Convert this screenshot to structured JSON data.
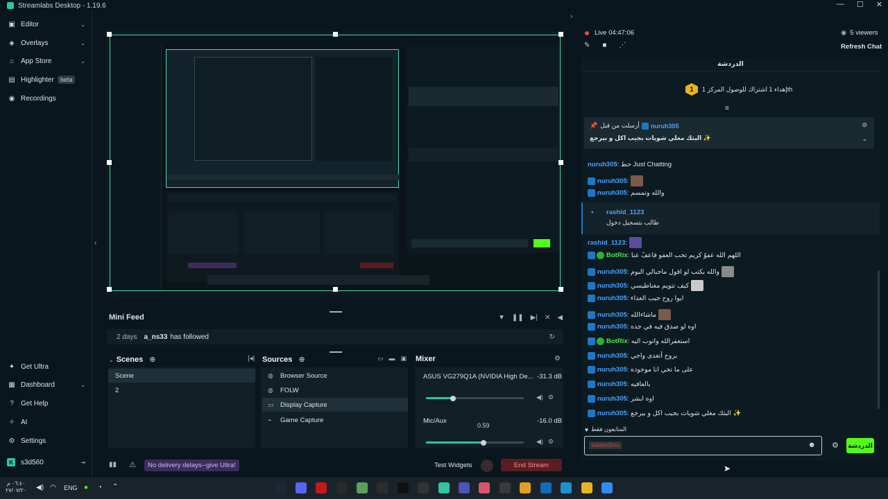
{
  "window": {
    "title": "Streamlabs Desktop - 1.19.6"
  },
  "nav": {
    "items": [
      {
        "label": "Editor"
      },
      {
        "label": "Overlays"
      },
      {
        "label": "App Store"
      },
      {
        "label": "Highlighter",
        "badge": "beta"
      },
      {
        "label": "Recordings"
      }
    ],
    "bottom_items": [
      {
        "label": "Get Ultra"
      },
      {
        "label": "Dashboard"
      },
      {
        "label": "Get Help"
      },
      {
        "label": "AI"
      },
      {
        "label": "Settings"
      }
    ],
    "user": "s3d560"
  },
  "minifeed": {
    "title": "Mini Feed",
    "age": "2 days",
    "user": "a_ns33",
    "event": "has followed"
  },
  "scenes": {
    "title": "Scenes",
    "items": [
      "Scene",
      "2"
    ]
  },
  "sources": {
    "title": "Sources",
    "items": [
      "Browser Source",
      "FOLW",
      "Display Capture",
      "Game Capture"
    ]
  },
  "mixer": {
    "title": "Mixer",
    "items": [
      {
        "name": "ASUS VG279Q1A (NVIDIA High De...",
        "db": "-31.3 dB",
        "level": 0.28
      },
      {
        "name": "Mic/Aux",
        "db": "-16.0 dB",
        "tooltip": "0.59",
        "level": 0.59
      }
    ]
  },
  "footer": {
    "upsell": "No delivery delays--give Ultra!",
    "test_widgets": "Test Widgets",
    "end_stream": "End Stream"
  },
  "live": {
    "status": "Live 04:47:06",
    "viewers": "5 viewers",
    "refresh": "Refresh Chat"
  },
  "chat": {
    "header": "الدردشة",
    "goal_text": "إهداء 1 اشتراك للوصول المركز 1th",
    "goal_rank": "1",
    "pinned": {
      "by_prefix": "أرسلت من قبل",
      "by_user": "nuruh305",
      "text": "البثك مغلي شويات بجيب اكل و بيرجع ✨"
    },
    "messages": [
      {
        "user": "nuruh305",
        "text": "حط Just Chatting"
      },
      {
        "user": "nuruh305",
        "text": ""
      },
      {
        "user": "nuruh305",
        "text": "والله وتمسم"
      },
      {
        "user": "rashid_1123",
        "text": "طالب بتسجيل دخول",
        "highlight": true
      },
      {
        "user": "rashid_1123",
        "text": ""
      },
      {
        "user": "BotRix",
        "text": "اللهم الله عفوٌ كريم تحب العفو فاعفُ عنا",
        "bot": true
      },
      {
        "user": "nuruh305",
        "text": "والله بكتب لو اقول ماجبالي اليوم"
      },
      {
        "user": "nuruh305",
        "text": "كيف تتويم مغناطيسي"
      },
      {
        "user": "nuruh305",
        "text": "ايوا روح جيب الغداء"
      },
      {
        "user": "nuruh305",
        "text": "ماشاءالله"
      },
      {
        "user": "nuruh305",
        "text": "اوه لو صدق فيه في جده"
      },
      {
        "user": "BotRix",
        "text": "استغفرالله واتوب اليه",
        "bot": true
      },
      {
        "user": "nuruh305",
        "text": "بروح أتغدى واجي"
      },
      {
        "user": "nuruh305",
        "text": "على ما تجي انا موجوده"
      },
      {
        "user": "nuruh305",
        "text": "بالعافيه"
      },
      {
        "user": "nuruh305",
        "text": "اوه ابشر"
      },
      {
        "user": "nuruh305",
        "text": "البثك مغلي شويات بجيب اكل و بيرجع ✨"
      }
    ],
    "followers_only": "المتابعون فقط",
    "input_value": "salandmu",
    "send_label": "الدردشة"
  },
  "taskbar": {
    "lang": "ENG",
    "time": "٠٦:٤٠ م",
    "date": "٢٧/٠٧/٢٠"
  }
}
